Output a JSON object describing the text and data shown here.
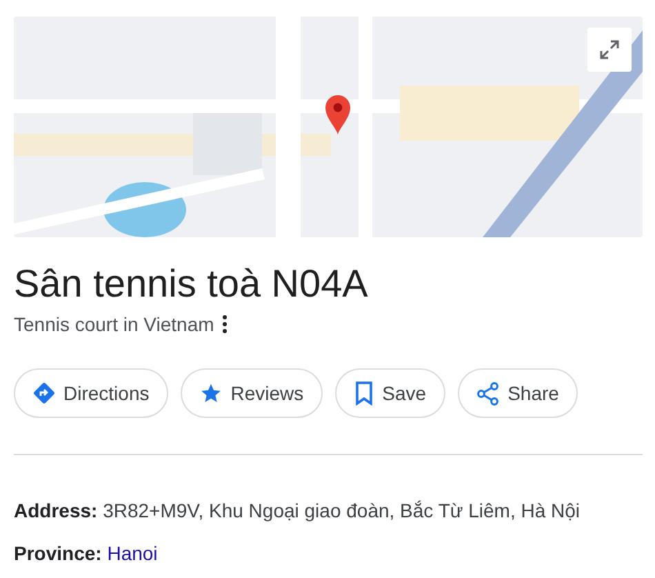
{
  "title": "Sân tennis toà N04A",
  "subtitle": "Tennis court in Vietnam",
  "actions": [
    {
      "kind": "directions",
      "label": "Directions"
    },
    {
      "kind": "reviews",
      "label": "Reviews"
    },
    {
      "kind": "save",
      "label": "Save"
    },
    {
      "kind": "share",
      "label": "Share"
    }
  ],
  "details": [
    {
      "label": "Address:",
      "value": "3R82+M9V, Khu Ngoại giao đoàn, Bắc Từ Liêm, Hà Nội",
      "link": false
    },
    {
      "label": "Province:",
      "value": "Hanoi",
      "link": true
    }
  ]
}
